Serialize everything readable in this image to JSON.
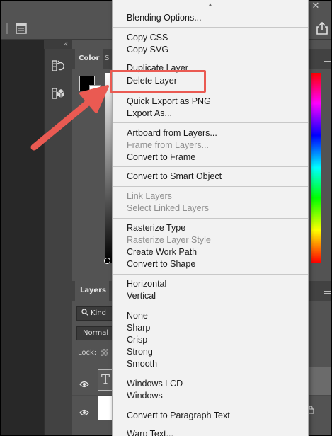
{
  "colors": {
    "panel_bg": "#535353",
    "menu_bg": "#f2f2f2",
    "annotation": "#ea5a52",
    "foreground_swatch": "#000000",
    "background_swatch": "#ffffff"
  },
  "topbar": {
    "close_glyph": "✕",
    "icons": [
      "document-icon",
      "share-icon",
      "close-icon"
    ]
  },
  "side_strip": {
    "collapse_glyph": "«",
    "icons": [
      "history-icon",
      "3d-cube-icon"
    ]
  },
  "color_panel": {
    "tab_label": "Color",
    "tab2_label": "S"
  },
  "layers_panel": {
    "tab_label": "Layers",
    "filter_label": "Kind",
    "blend_mode": "Normal",
    "lock_label": "Lock:",
    "layers": [
      {
        "thumb_glyph": "T",
        "type": "text"
      },
      {
        "thumb_glyph": "",
        "type": "fill"
      }
    ]
  },
  "context_menu": {
    "scroll_up_glyph": "▲",
    "groups": [
      {
        "items": [
          {
            "label": "Blending Options...",
            "enabled": true
          }
        ]
      },
      {
        "items": [
          {
            "label": "Copy CSS",
            "enabled": true
          },
          {
            "label": "Copy SVG",
            "enabled": true
          }
        ]
      },
      {
        "items": [
          {
            "label": "Duplicate Layer",
            "enabled": true
          },
          {
            "label": "Delete Layer",
            "enabled": true,
            "highlighted": true
          }
        ]
      },
      {
        "items": [
          {
            "label": "Quick Export as PNG",
            "enabled": true
          },
          {
            "label": "Export As...",
            "enabled": true
          }
        ]
      },
      {
        "items": [
          {
            "label": "Artboard from Layers...",
            "enabled": true
          },
          {
            "label": "Frame from Layers...",
            "enabled": false
          },
          {
            "label": "Convert to Frame",
            "enabled": true
          }
        ]
      },
      {
        "items": [
          {
            "label": "Convert to Smart Object",
            "enabled": true
          }
        ]
      },
      {
        "items": [
          {
            "label": "Link Layers",
            "enabled": false
          },
          {
            "label": "Select Linked Layers",
            "enabled": false
          }
        ]
      },
      {
        "items": [
          {
            "label": "Rasterize Type",
            "enabled": true
          },
          {
            "label": "Rasterize Layer Style",
            "enabled": false
          },
          {
            "label": "Create Work Path",
            "enabled": true
          },
          {
            "label": "Convert to Shape",
            "enabled": true
          }
        ]
      },
      {
        "items": [
          {
            "label": "Horizontal",
            "enabled": true
          },
          {
            "label": "Vertical",
            "enabled": true
          }
        ]
      },
      {
        "items": [
          {
            "label": "None",
            "enabled": true
          },
          {
            "label": "Sharp",
            "enabled": true
          },
          {
            "label": "Crisp",
            "enabled": true
          },
          {
            "label": "Strong",
            "enabled": true
          },
          {
            "label": "Smooth",
            "enabled": true
          }
        ]
      },
      {
        "items": [
          {
            "label": "Windows LCD",
            "enabled": true
          },
          {
            "label": "Windows",
            "enabled": true
          }
        ]
      },
      {
        "items": [
          {
            "label": "Convert to Paragraph Text",
            "enabled": true
          }
        ]
      },
      {
        "items": [
          {
            "label": "Warp Text...",
            "enabled": true,
            "partially_visible": true
          }
        ]
      }
    ]
  },
  "annotation": {
    "type": "arrow-and-box",
    "target": "Delete Layer"
  }
}
